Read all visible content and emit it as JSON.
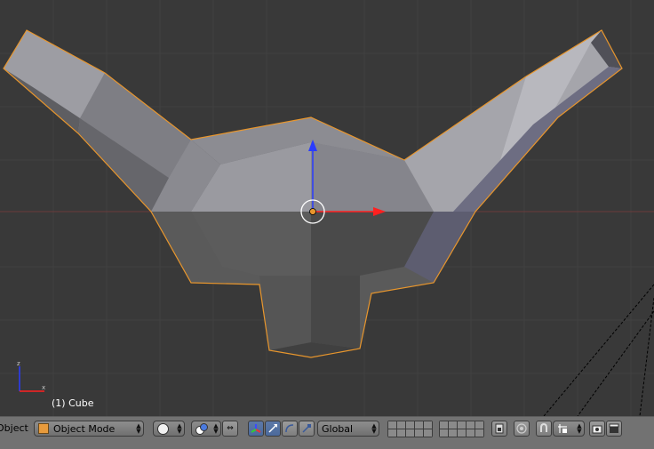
{
  "viewport": {
    "object_info": "(1) Cube",
    "background": "#393939",
    "mesh_color_light": "#a9a9b0",
    "mesh_color_dark": "#505050",
    "selection_outline": "#e8962d"
  },
  "header": {
    "menu_label": "Object",
    "mode_select": {
      "label": "Object Mode",
      "icon": "cube-icon"
    },
    "shading_select": {
      "icon": "solid-sphere-icon"
    },
    "pivot_select": {
      "icon": "pivot-point-icon"
    },
    "manipulator_icons": [
      "manipulator-toggle-icon",
      "translate-icon",
      "rotate-icon",
      "scale-icon"
    ],
    "orientation_select": {
      "label": "Global"
    },
    "layer_groups": 2,
    "right_icons": [
      "lock-camera-icon",
      "proportional-edit-icon",
      "snap-toggle-icon",
      "snap-element-icon",
      "render-icon",
      "render-animation-icon"
    ]
  }
}
